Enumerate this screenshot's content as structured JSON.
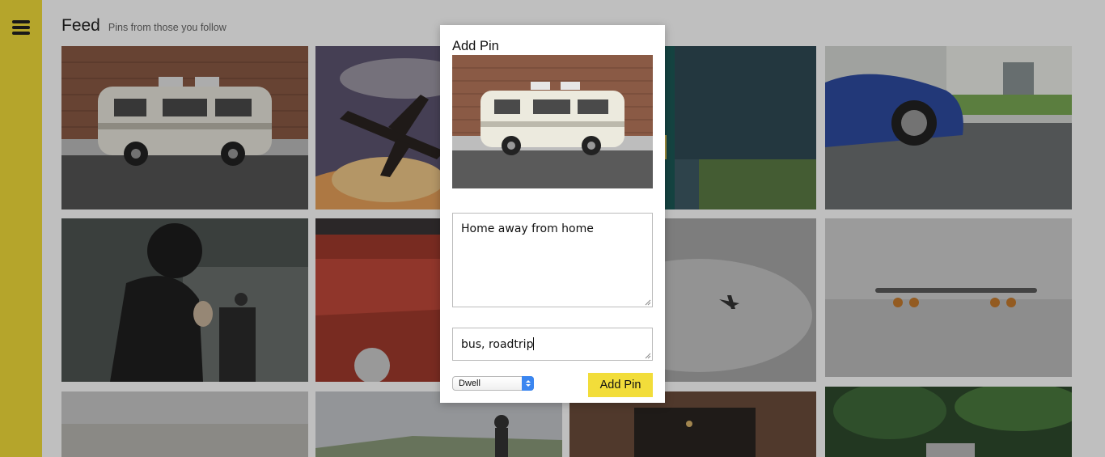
{
  "sidebar": {
    "menu_icon": "hamburger-menu-icon"
  },
  "header": {
    "title": "Feed",
    "subtitle": "Pins from those you follow"
  },
  "feed": {
    "pins": [
      {
        "subject": "white camper van"
      },
      {
        "subject": "vintage airplane in smoke"
      },
      {
        "subject": "auto rickshaw taxi"
      },
      {
        "subject": "blue sports car"
      },
      {
        "subject": "motorcyclist in helmet"
      },
      {
        "subject": "red vintage car hood"
      },
      {
        "subject": "airplane in cloudy sky"
      },
      {
        "subject": "longboard skateboard"
      },
      {
        "subject": "hazy landscape"
      },
      {
        "subject": "person on hill"
      },
      {
        "subject": "dark hallway"
      },
      {
        "subject": "forest road"
      }
    ]
  },
  "modal": {
    "title": "Add Pin",
    "description_value": "Home away from home",
    "tags_value": "bus, roadtrip",
    "board_select": {
      "selected": "Dwell"
    },
    "submit_label": "Add Pin"
  },
  "colors": {
    "accent": "#f2dd3a",
    "select_accent": "#3b86f0"
  }
}
